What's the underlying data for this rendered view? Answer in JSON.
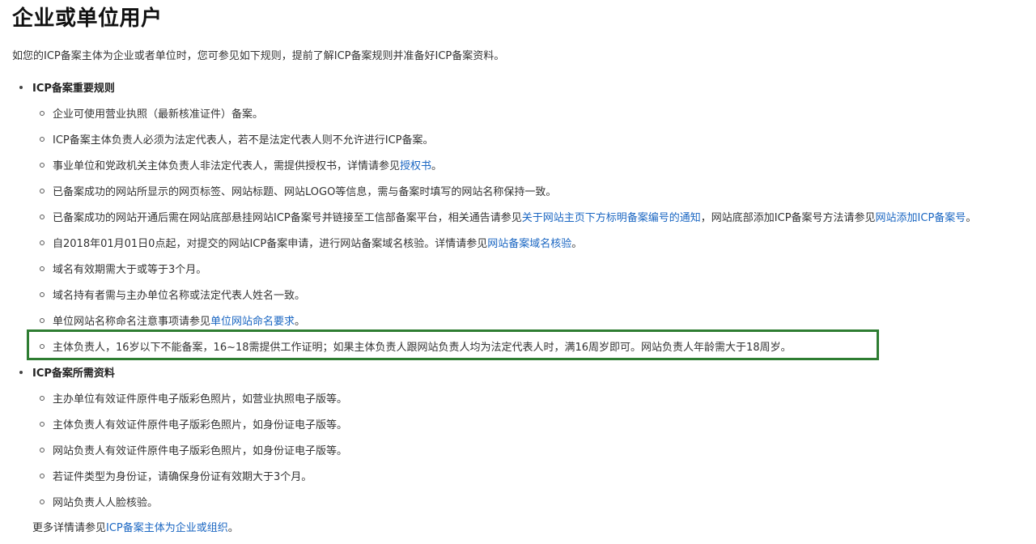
{
  "title": "企业或单位用户",
  "intro": "如您的ICP备案主体为企业或者单位时，您可参见如下规则，提前了解ICP备案规则并准备好ICP备案资料。",
  "rules_section": {
    "heading": "ICP备案重要规则",
    "items": [
      {
        "text": "企业可使用营业执照（最新核准证件）备案。"
      },
      {
        "text": "ICP备案主体负责人必须为法定代表人，若不是法定代表人则不允许进行ICP备案。"
      },
      {
        "pre": "事业单位和党政机关主体负责人非法定代表人，需提供授权书，详情请参见",
        "link": "授权书",
        "post": "。"
      },
      {
        "text": "已备案成功的网站所显示的网页标签、网站标题、网站LOGO等信息，需与备案时填写的网站名称保持一致。"
      },
      {
        "pre": "已备案成功的网站开通后需在网站底部悬挂网站ICP备案号并链接至工信部备案平台，相关通告请参见",
        "link": "关于网站主页下方标明备案编号的通知",
        "mid": "，网站底部添加ICP备案号方法请参见",
        "link2": "网站添加ICP备案号",
        "post": "。"
      },
      {
        "pre": "自2018年01月01日0点起，对提交的网站ICP备案申请，进行网站备案域名核验。详情请参见",
        "link": "网站备案域名核验",
        "post": "。"
      },
      {
        "text": "域名有效期需大于或等于3个月。"
      },
      {
        "text": "域名持有者需与主办单位名称或法定代表人姓名一致。"
      },
      {
        "pre": "单位网站名称命名注意事项请参见",
        "link": "单位网站命名要求",
        "post": "。"
      },
      {
        "text": "主体负责人，16岁以下不能备案，16~18需提供工作证明；如果主体负责人跟网站负责人均为法定代表人时，满16周岁即可。网站负责人年龄需大于18周岁。"
      }
    ]
  },
  "materials_section": {
    "heading": "ICP备案所需资料",
    "items": [
      {
        "text": "主办单位有效证件原件电子版彩色照片，如营业执照电子版等。"
      },
      {
        "text": "主体负责人有效证件原件电子版彩色照片，如身份证电子版等。"
      },
      {
        "text": "网站负责人有效证件原件电子版彩色照片，如身份证电子版等。"
      },
      {
        "text": "若证件类型为身份证，请确保身份证有效期大于3个月。"
      },
      {
        "text": "网站负责人人脸核验。"
      }
    ]
  },
  "footer": {
    "pre": "更多详情请参见",
    "link": "ICP备案主体为企业或组织",
    "post": "。"
  },
  "colors": {
    "link": "#1a66c2",
    "highlight_border": "#2e7d32"
  }
}
